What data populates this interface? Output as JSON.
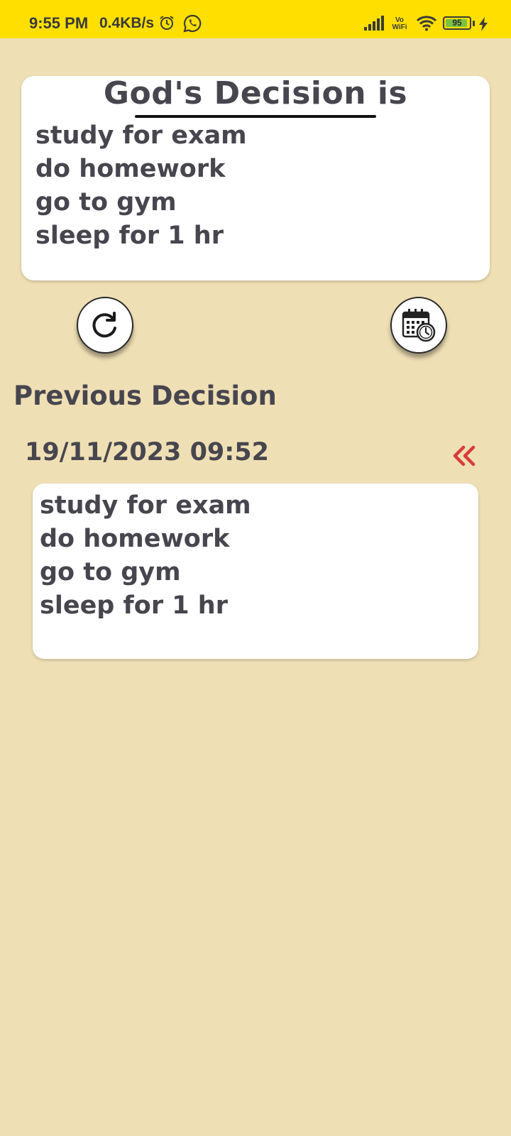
{
  "status_bar": {
    "time": "9:55 PM",
    "network_speed": "0.4KB/s",
    "vowifi_top": "Vo",
    "vowifi_bottom": "WiFi",
    "battery_percent": "95",
    "battery_level": 0.95,
    "icons": [
      "alarm-icon",
      "whatsapp-icon",
      "signal-icon",
      "wifi-icon",
      "battery-icon",
      "charging-icon"
    ]
  },
  "decision": {
    "title": "God's Decision is",
    "items": [
      "study for exam",
      "do homework",
      "go to gym",
      "sleep for 1 hr"
    ]
  },
  "actions": {
    "refresh_icon": "refresh-icon",
    "history_icon": "calendar-clock-icon"
  },
  "previous": {
    "heading": "Previous Decision",
    "entries": [
      {
        "datetime": "19/11/2023 09:52",
        "items": [
          "study for exam",
          "do homework",
          "go to gym",
          "sleep for 1 hr"
        ]
      }
    ],
    "collapse_icon": "double-chevron-left-icon"
  },
  "colors": {
    "background": "#efdfb4",
    "status_bar": "#ffdf00",
    "text": "#47464f",
    "accent_red": "#d93b3b",
    "card": "#ffffff"
  }
}
